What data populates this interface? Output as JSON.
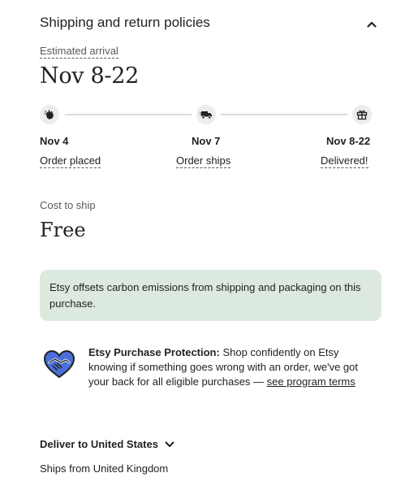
{
  "section": {
    "title": "Shipping and return policies"
  },
  "arrival": {
    "label": "Estimated arrival",
    "date": "Nov 8-22"
  },
  "steps": [
    {
      "date": "Nov 4",
      "label": "Order placed",
      "icon": "hand-wave-icon"
    },
    {
      "date": "Nov 7",
      "label": "Order ships",
      "icon": "truck-icon"
    },
    {
      "date": "Nov 8-22",
      "label": "Delivered!",
      "icon": "gift-icon"
    }
  ],
  "cost": {
    "label": "Cost to ship",
    "value": "Free"
  },
  "carbon": {
    "text": "Etsy offsets carbon emissions from shipping and packaging on this purchase."
  },
  "protection": {
    "title": "Etsy Purchase Protection:",
    "body": " Shop confidently on Etsy knowing if something goes wrong with an order, we've got your back for all eligible purchases — ",
    "link": "see program terms",
    "icon": "handshake-heart-icon"
  },
  "delivery": {
    "deliver_to": "Deliver to United States",
    "ships_from": "Ships from United Kingdom"
  },
  "colors": {
    "carbon_bg": "#dce9df",
    "icon_bg": "#ececec",
    "protect_blue": "#4a6fd9"
  }
}
